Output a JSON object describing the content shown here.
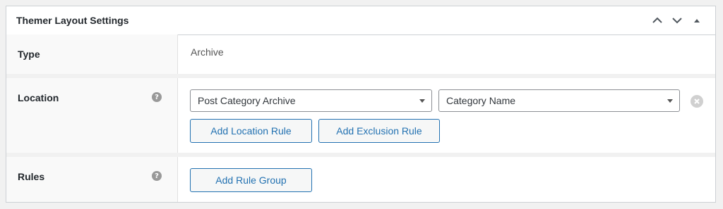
{
  "metabox": {
    "title": "Themer Layout Settings",
    "controls": {
      "move_up_icon": "chevron-up-icon",
      "move_down_icon": "chevron-down-icon",
      "toggle_icon": "triangle-up-icon"
    }
  },
  "rows": {
    "type": {
      "label": "Type",
      "value": "Archive"
    },
    "location": {
      "label": "Location",
      "help": "?",
      "primary_select": "Post Category Archive",
      "secondary_select": "Category Name",
      "add_location_rule": "Add Location Rule",
      "add_exclusion_rule": "Add Exclusion Rule"
    },
    "rules": {
      "label": "Rules",
      "help": "?",
      "add_rule_group": "Add Rule Group"
    }
  },
  "colors": {
    "accent": "#2271b1",
    "border": "#ccd0d4",
    "label_bg": "#f9f9f9",
    "help_icon": "#999999"
  }
}
